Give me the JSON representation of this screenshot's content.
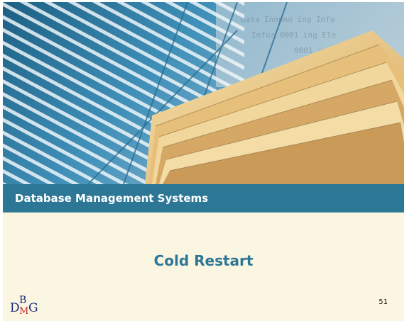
{
  "slide": {
    "title": "Database Management Systems",
    "subtitle": "Cold Restart",
    "page_number": "51"
  },
  "logo": {
    "letters": [
      "D",
      "B",
      "M",
      "G"
    ]
  },
  "banner": {
    "description_icon": "stacked-folders-photo",
    "colors": {
      "sky": "#2f7fa8",
      "folders": "#e9c98a",
      "title_bar": "#2d7796",
      "background": "#fbf6e2",
      "subtitle": "#2d7796"
    }
  }
}
